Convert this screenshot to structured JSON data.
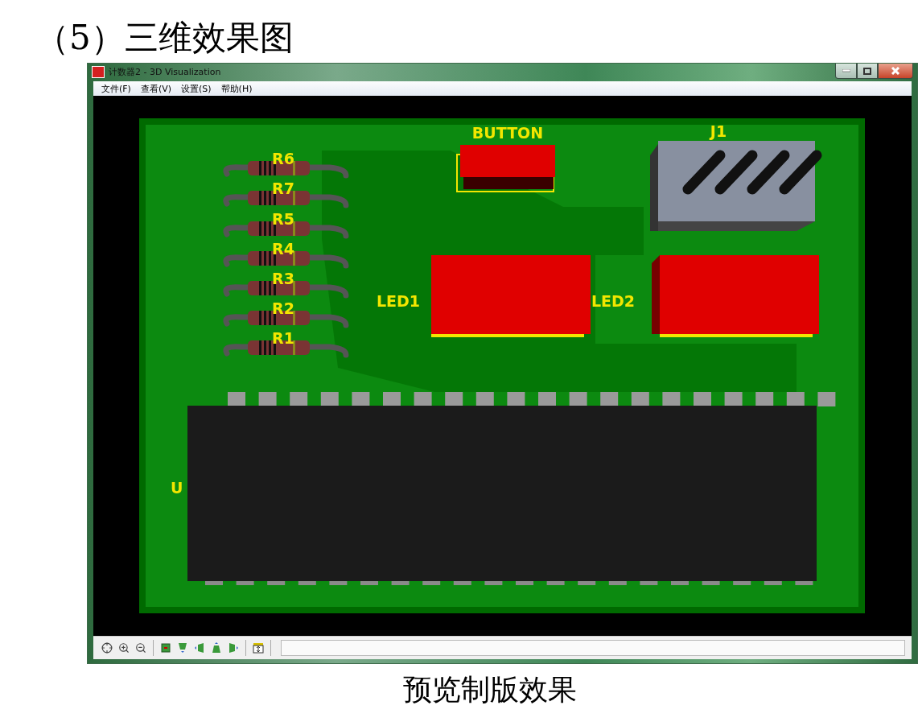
{
  "heading": "（5）三维效果图",
  "window": {
    "title": "计数器2 - 3D Visualization"
  },
  "menu": [
    "文件(F)",
    "查看(V)",
    "设置(S)",
    "帮助(H)"
  ],
  "board": {
    "components": [
      {
        "kind": "button",
        "label": "BUTTON"
      },
      {
        "kind": "header",
        "label": "J1"
      },
      {
        "kind": "resistor",
        "label": "R6"
      },
      {
        "kind": "resistor",
        "label": "R7"
      },
      {
        "kind": "resistor",
        "label": "R5"
      },
      {
        "kind": "resistor",
        "label": "R4"
      },
      {
        "kind": "resistor",
        "label": "R3"
      },
      {
        "kind": "resistor",
        "label": "R2"
      },
      {
        "kind": "resistor",
        "label": "R1"
      },
      {
        "kind": "led",
        "label": "LED1"
      },
      {
        "kind": "led",
        "label": "LED2"
      },
      {
        "kind": "chip",
        "label": "U"
      }
    ]
  },
  "caption": "预览制版效果"
}
